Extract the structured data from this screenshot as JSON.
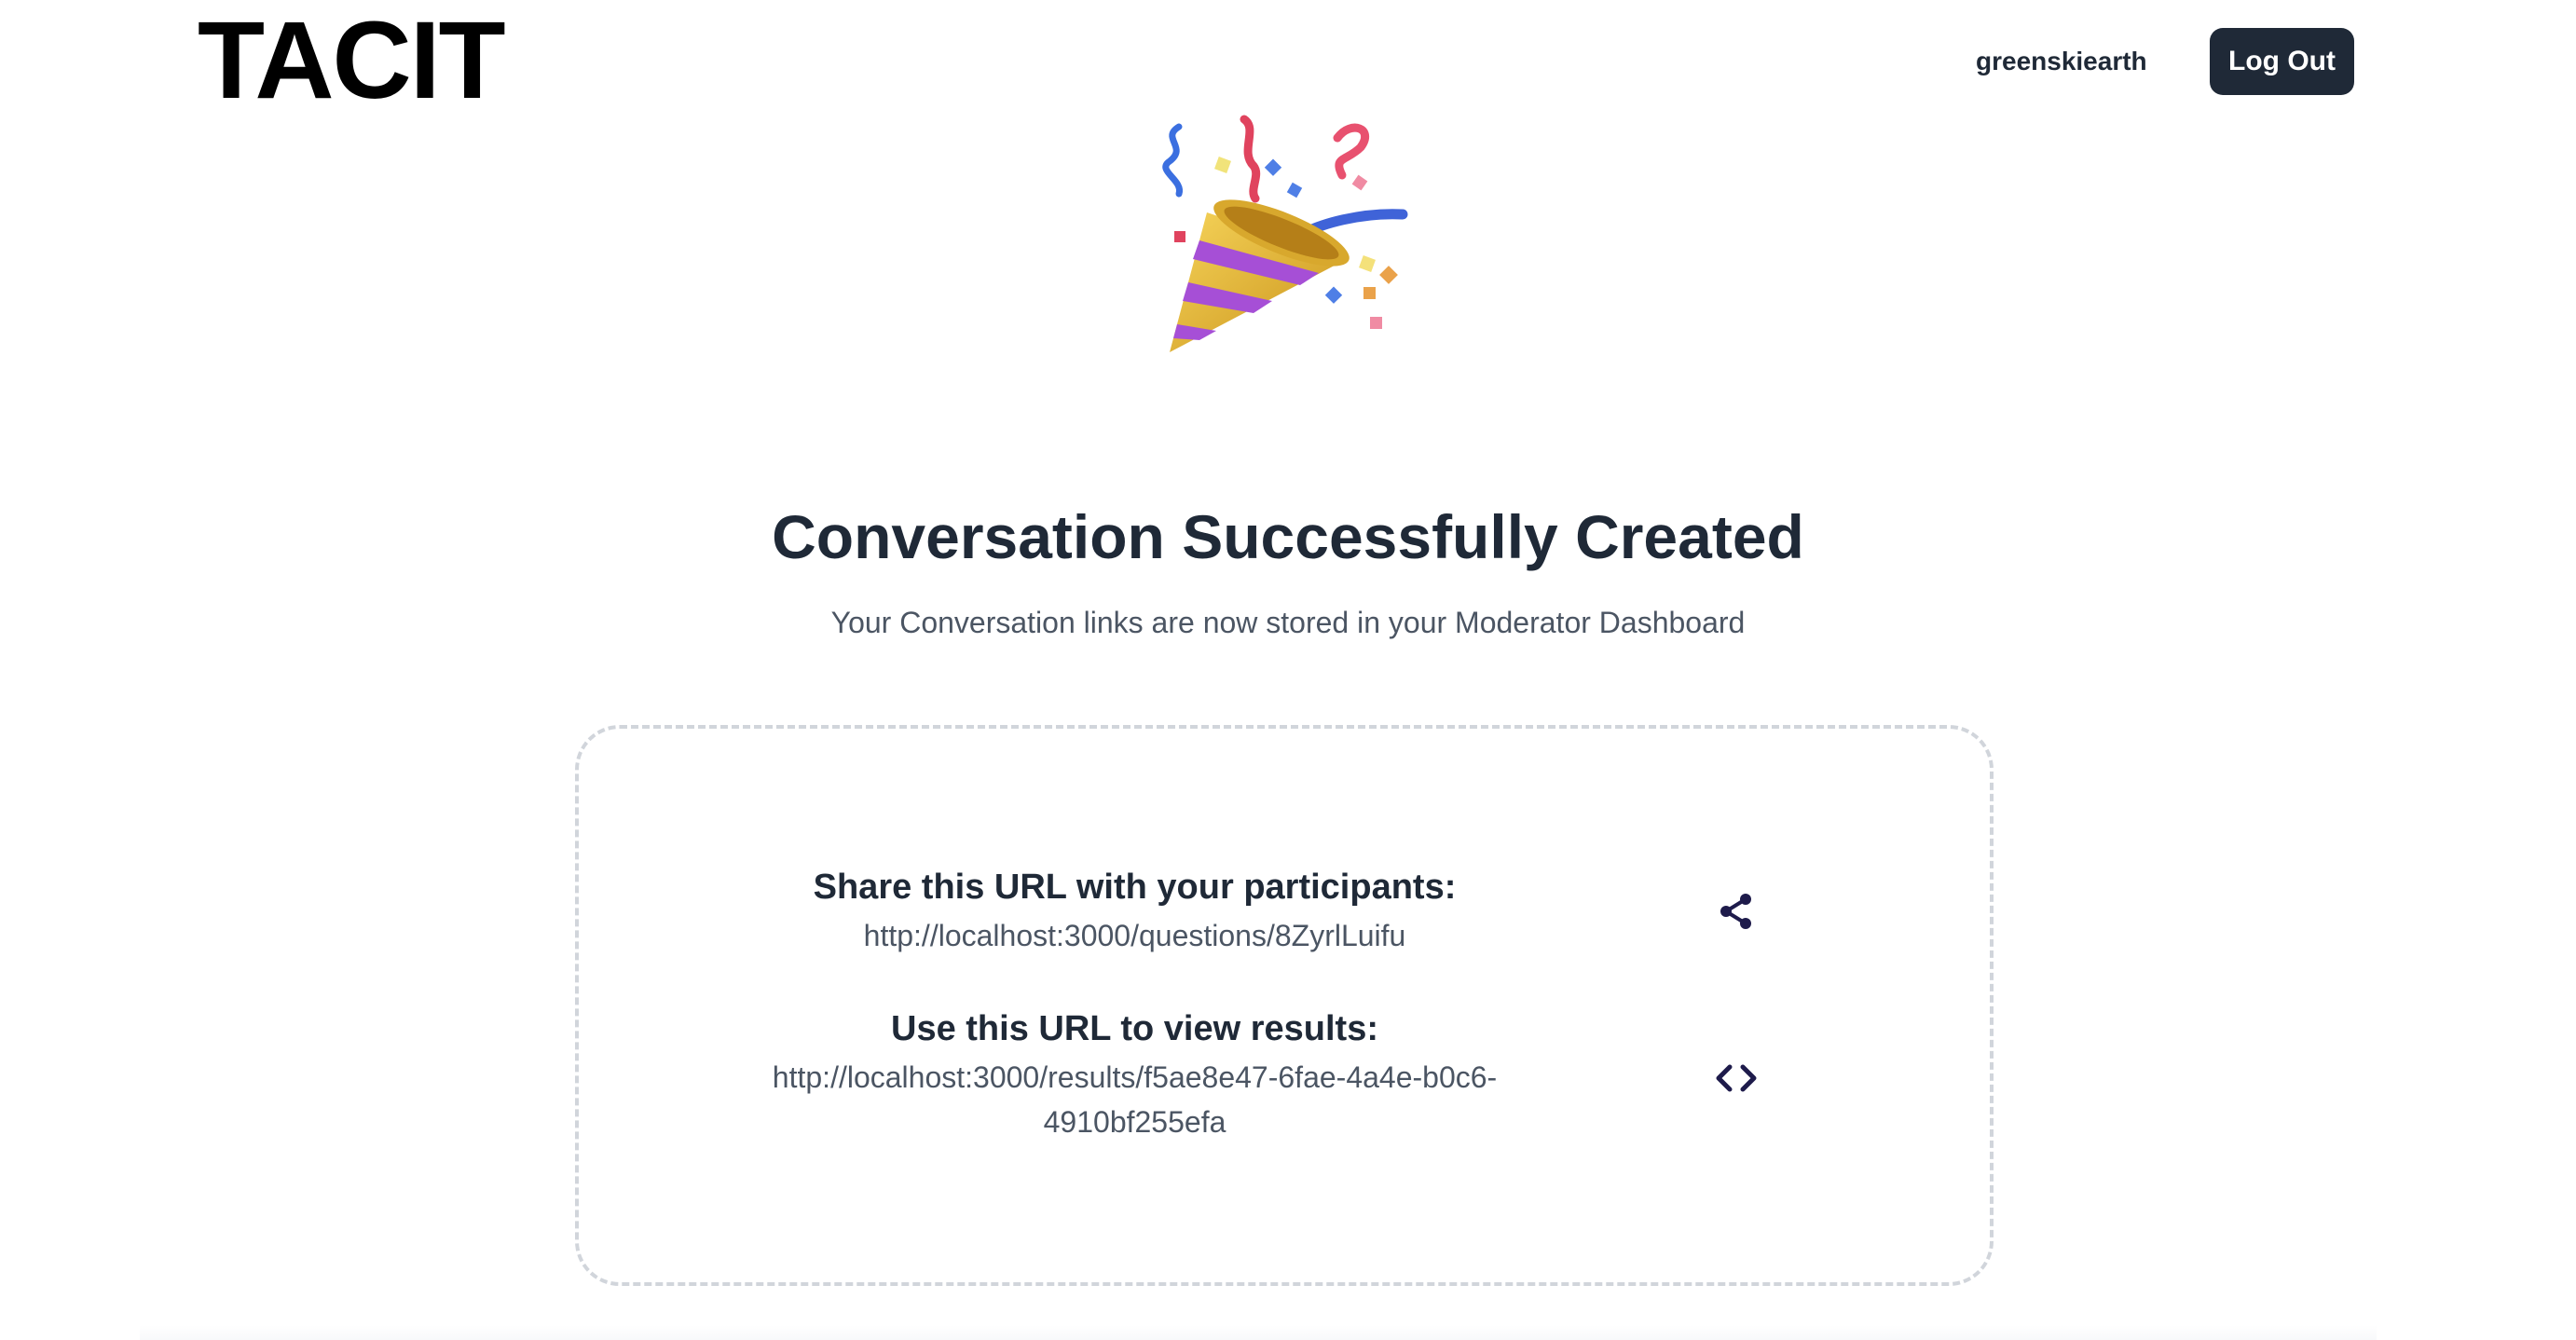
{
  "header": {
    "logo_text": "TACIT",
    "username": "greenskiearth",
    "logout_label": "Log Out"
  },
  "hero": {
    "emoji_icon": "party-popper-icon",
    "title": "Conversation Successfully Created",
    "subtitle": "Your Conversation links are now stored in your Moderator Dashboard"
  },
  "links": {
    "share_label": "Share this URL with your participants:",
    "share_url": "http://localhost:3000/questions/8ZyrlLuifu",
    "share_icon": "share-icon",
    "results_label": "Use this URL to view results:",
    "results_url": "http://localhost:3000/results/f5ae8e47-6fae-4a4e-b0c6-4910bf255efa",
    "results_icon": "code-icon"
  },
  "colors": {
    "text_dark": "#1f2937",
    "text_muted": "#4b5563",
    "button_bg": "#1f2937",
    "icon_color": "#1e1b4b",
    "card_border": "#d1d5db"
  }
}
